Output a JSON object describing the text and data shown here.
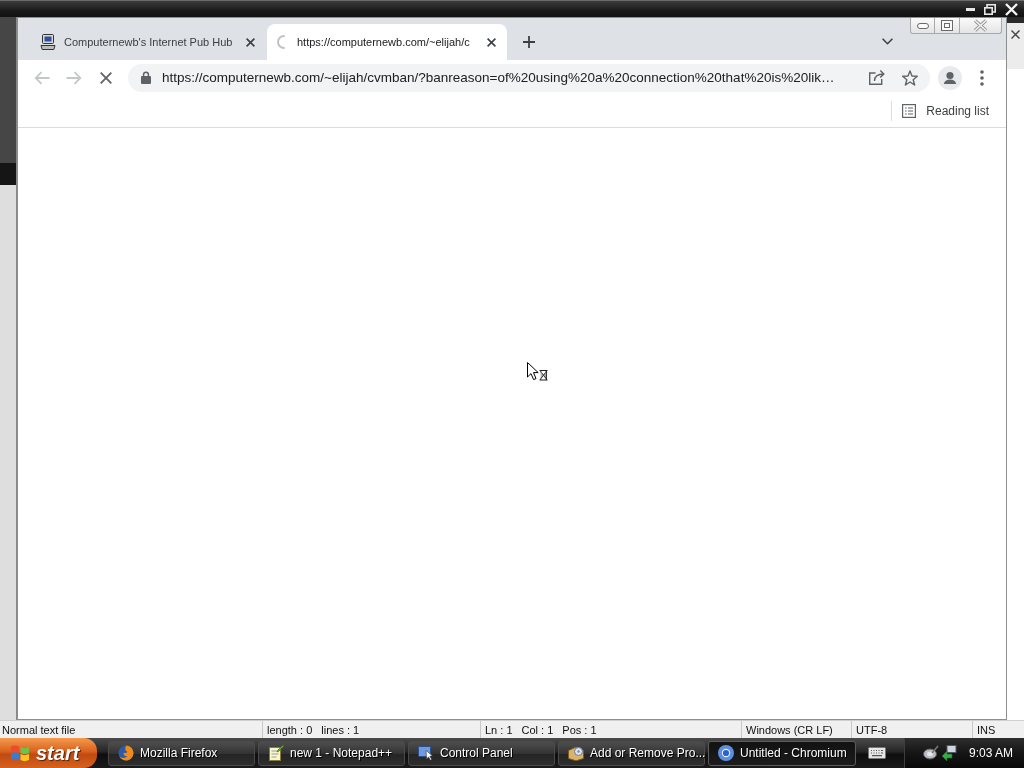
{
  "notepad_window": {
    "status_bar": [
      [
        "Normal text file"
      ],
      [
        "length : 0",
        "lines : 1"
      ],
      [
        "Ln : 1",
        "Col : 1",
        "Pos : 1"
      ],
      [
        "Windows (CR LF)"
      ],
      [
        "UTF-8"
      ],
      [
        "INS"
      ]
    ]
  },
  "browser": {
    "tabs": [
      {
        "title": "Computernewb's Internet Pub Hub",
        "selected": false,
        "loading": false
      },
      {
        "title": "https://computernewb.com/~elijah/c",
        "selected": true,
        "loading": true
      }
    ],
    "toolbar": {
      "back": {
        "disabled": true
      },
      "forward": {
        "disabled": true
      },
      "loading": true
    },
    "address_bar": {
      "url": "https://computernewb.com/~elijah/cvmban/?banreason=of%20using%20a%20connection%20that%20is%20lik…",
      "secure": true
    },
    "bookmarks_bar": {
      "reading_list": "Reading list"
    }
  },
  "taskbar": {
    "start": "start",
    "tasks": [
      {
        "label": "Mozilla Firefox",
        "kind": "globe",
        "selected": false
      },
      {
        "label": "new 1 - Notepad++",
        "kind": "notepad",
        "selected": false
      },
      {
        "label": "Control Panel",
        "kind": "panel",
        "selected": false
      },
      {
        "label": "Add or Remove Pro...",
        "kind": "installer",
        "selected": false
      },
      {
        "label": "Untitled - Chromium",
        "kind": "sphere",
        "selected": true
      }
    ],
    "clock": "9:03 AM"
  }
}
